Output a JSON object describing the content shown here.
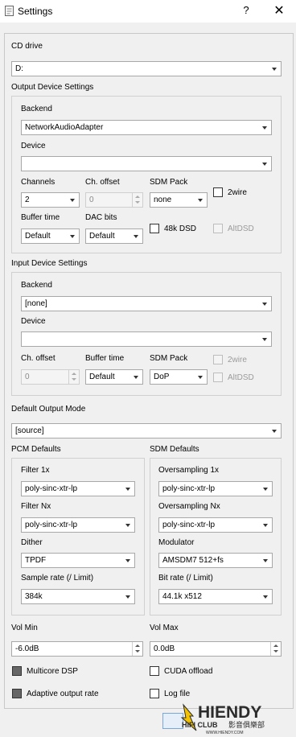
{
  "window": {
    "title": "Settings",
    "help": "?",
    "close": "✕"
  },
  "cd": {
    "label": "CD drive",
    "value": "D:"
  },
  "output": {
    "group_label": "Output Device Settings",
    "backend_label": "Backend",
    "backend_value": "NetworkAudioAdapter",
    "device_label": "Device",
    "device_value": "",
    "channels_label": "Channels",
    "channels_value": "2",
    "ch_offset_label": "Ch. offset",
    "ch_offset_value": "0",
    "sdm_pack_label": "SDM Pack",
    "sdm_pack_value": "none",
    "twowire_label": "2wire",
    "buffer_time_label": "Buffer time",
    "buffer_time_value": "Default",
    "dac_bits_label": "DAC bits",
    "dac_bits_value": "Default",
    "dsd48k_label": "48k DSD",
    "altdsd_label": "AltDSD"
  },
  "input": {
    "group_label": "Input Device Settings",
    "backend_label": "Backend",
    "backend_value": "[none]",
    "device_label": "Device",
    "device_value": "",
    "ch_offset_label": "Ch. offset",
    "ch_offset_value": "0",
    "buffer_time_label": "Buffer time",
    "buffer_time_value": "Default",
    "sdm_pack_label": "SDM Pack",
    "sdm_pack_value": "DoP",
    "twowire_label": "2wire",
    "altdsd_label": "AltDSD"
  },
  "output_mode": {
    "label": "Default Output Mode",
    "value": "[source]"
  },
  "pcm": {
    "group_label": "PCM Defaults",
    "filter1x_label": "Filter 1x",
    "filter1x_value": "poly-sinc-xtr-lp",
    "filternx_label": "Filter Nx",
    "filternx_value": "poly-sinc-xtr-lp",
    "dither_label": "Dither",
    "dither_value": "TPDF",
    "samplerate_label": "Sample rate (/ Limit)",
    "samplerate_value": "384k"
  },
  "sdm": {
    "group_label": "SDM Defaults",
    "os1x_label": "Oversampling 1x",
    "os1x_value": "poly-sinc-xtr-lp",
    "osnx_label": "Oversampling Nx",
    "osnx_value": "poly-sinc-xtr-lp",
    "modulator_label": "Modulator",
    "modulator_value": "AMSDM7 512+fs",
    "bitrate_label": "Bit rate (/ Limit)",
    "bitrate_value": "44.1k x512"
  },
  "volume": {
    "min_label": "Vol Min",
    "min_value": "-6.0dB",
    "max_label": "Vol Max",
    "max_value": "0.0dB"
  },
  "options": {
    "multicore_label": "Multicore DSP",
    "cuda_label": "CUDA offload",
    "adaptive_label": "Adaptive output rate",
    "logfile_label": "Log file"
  },
  "watermark": {
    "brand": "HIENDY",
    "club": "HIFI CLUB",
    "cn": "影音俱樂部",
    "url": "WWW.HIENDY.COM",
    "colors": {
      "yellow": "#f2c200",
      "dark": "#2b2b2b"
    }
  }
}
